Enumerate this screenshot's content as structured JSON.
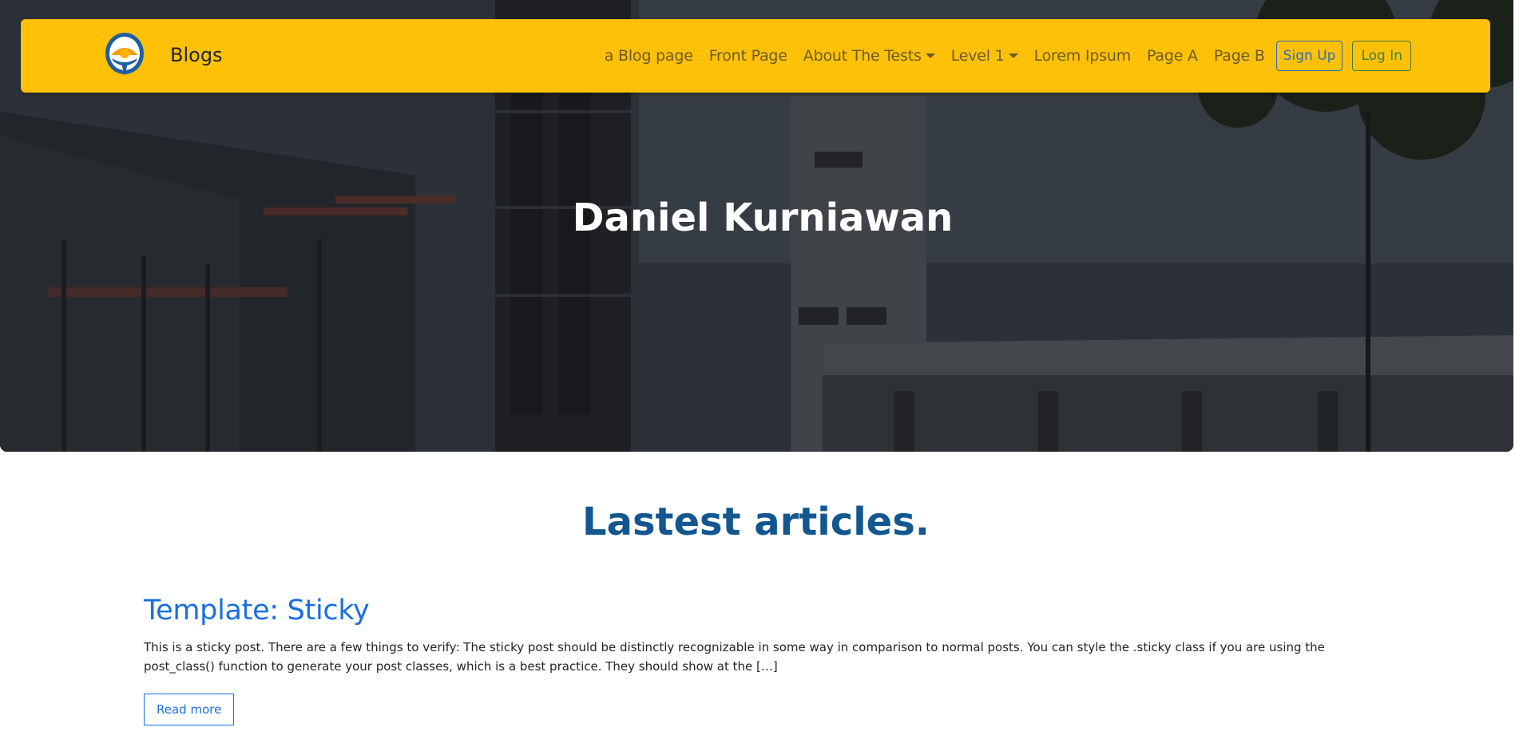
{
  "navbar": {
    "brand": "Blogs",
    "links": [
      {
        "label": "a Blog page"
      },
      {
        "label": "Front Page"
      },
      {
        "label": "About The Tests"
      },
      {
        "label": "Level 1"
      },
      {
        "label": "Lorem Ipsum"
      },
      {
        "label": "Page A"
      },
      {
        "label": "Page B"
      }
    ],
    "signup_label": "Sign Up",
    "login_label": "Log In",
    "background_color": "#ffc107"
  },
  "hero": {
    "title": "Daniel Kurniawan"
  },
  "main": {
    "section_title": "Lastest articles.",
    "posts": [
      {
        "title": "Template: Sticky",
        "excerpt": "This is a sticky post. There are a few things to verify: The sticky post should be distinctly recognizable in some way in comparison to normal posts. You can style the .sticky class if you are using the post_class() function to generate your post classes, which is a best practice. They should show at the […]",
        "read_more_label": "Read more"
      }
    ]
  },
  "colors": {
    "accent": "#ffc107",
    "heading": "#12578f",
    "link": "#1b6fe0"
  }
}
